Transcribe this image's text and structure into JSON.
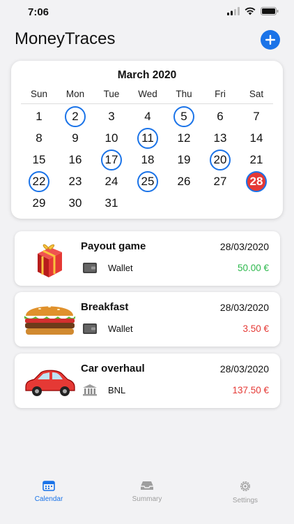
{
  "status": {
    "time": "7:06"
  },
  "header": {
    "title": "MoneyTraces"
  },
  "calendar": {
    "month": "March 2020",
    "weekdays": [
      "Sun",
      "Mon",
      "Tue",
      "Wed",
      "Thu",
      "Fri",
      "Sat"
    ],
    "days": [
      "1",
      "2",
      "3",
      "4",
      "5",
      "6",
      "7",
      "8",
      "9",
      "10",
      "11",
      "12",
      "13",
      "14",
      "15",
      "16",
      "17",
      "18",
      "19",
      "20",
      "21",
      "22",
      "23",
      "24",
      "25",
      "26",
      "27",
      "28",
      "29",
      "30",
      "31"
    ],
    "marked_days": [
      "2",
      "5",
      "11",
      "17",
      "20",
      "22",
      "25"
    ],
    "selected_day": "28"
  },
  "transactions": [
    {
      "title": "Payout game",
      "date": "28/03/2020",
      "account": "Wallet",
      "amount": "50.00 €",
      "amount_color": "#2db84d",
      "image": "gift-icon",
      "account_icon": "wallet-icon"
    },
    {
      "title": "Breakfast",
      "date": "28/03/2020",
      "account": "Wallet",
      "amount": "3.50 €",
      "amount_color": "#e53935",
      "image": "burger-icon",
      "account_icon": "wallet-icon"
    },
    {
      "title": "Car overhaul",
      "date": "28/03/2020",
      "account": "BNL",
      "amount": "137.50 €",
      "amount_color": "#e53935",
      "image": "car-icon",
      "account_icon": "bank-icon"
    }
  ],
  "tabs": [
    {
      "label": "Calendar",
      "icon": "calendar-icon",
      "active": true
    },
    {
      "label": "Summary",
      "icon": "tray-icon",
      "active": false
    },
    {
      "label": "Settings",
      "icon": "gear-icon",
      "active": false
    }
  ],
  "colors": {
    "accent": "#1a73e8",
    "today": "#e53935",
    "income": "#2db84d",
    "expense": "#e53935",
    "tab_inactive": "#9e9e9e"
  }
}
